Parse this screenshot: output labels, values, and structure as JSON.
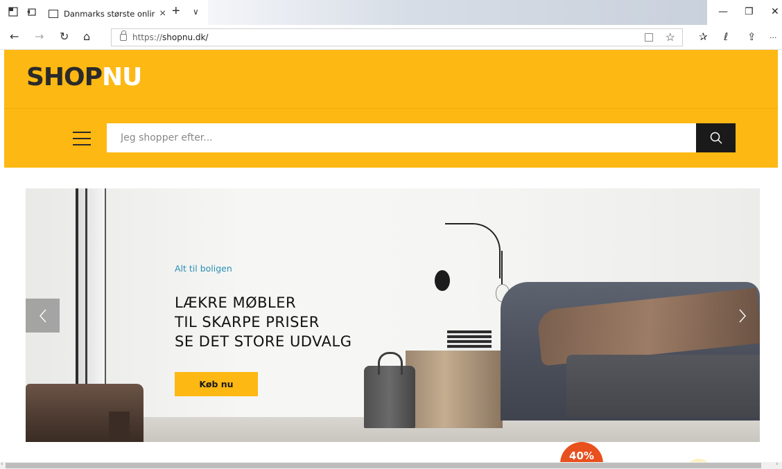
{
  "browser": {
    "tab_title": "Danmarks største onlir",
    "tab_close": "×",
    "new_tab": "+",
    "tab_list": "∨",
    "url_protocol": "https://",
    "url_host": "shopnu.dk/",
    "minimize": "—",
    "restore": "❐",
    "close": "✕",
    "back": "←",
    "forward": "→",
    "refresh": "↻",
    "home": "⌂",
    "favorite": "☆",
    "favorites_hub": "✰",
    "notes": "ℓ",
    "share": "⇪",
    "more": "···"
  },
  "site": {
    "logo_shop": "SHOP",
    "logo_nu": "NU",
    "search_placeholder": "Jeg shopper efter..."
  },
  "hero": {
    "subtitle": "Alt til boligen",
    "title_lines": [
      "LÆKRE MØBLER",
      "TIL SKARPE PRISER",
      "SE DET STORE UDVALG"
    ],
    "button_label": "Køb nu"
  },
  "badge": {
    "discount": "40%"
  },
  "colors": {
    "brand_yellow": "#fdb813",
    "dark": "#1a1a1a",
    "accent_blue": "#2b8fb5",
    "badge_orange": "#e8501e"
  }
}
